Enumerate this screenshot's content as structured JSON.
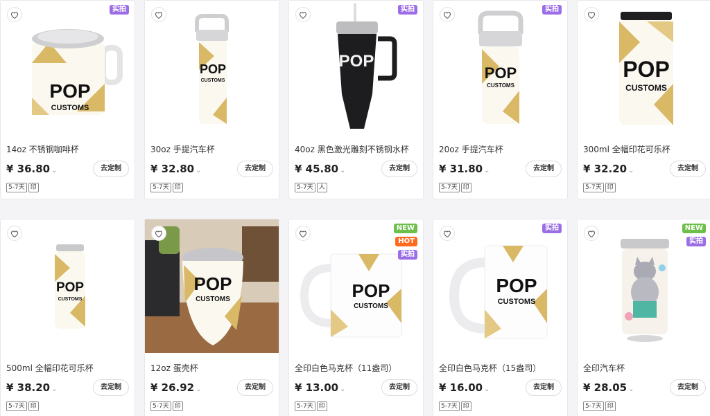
{
  "products": [
    {
      "title": "14oz 不锈钢咖啡杯",
      "price": "¥ 36.80",
      "btn": "去定制",
      "tag1": "5-7天",
      "tag2": "印",
      "badges": [
        "实拍"
      ],
      "brand1": "POP",
      "brand2": "CUSTOMS",
      "icon": "stainless-mug-icon"
    },
    {
      "title": "30oz 手提汽车杯",
      "price": "¥ 32.80",
      "btn": "去定制",
      "tag1": "5-7天",
      "tag2": "印",
      "badges": [],
      "brand1": "POP",
      "brand2": "CUSTOMS",
      "icon": "handle-tumbler-icon"
    },
    {
      "title": "40oz 黑色激光雕刻不锈钢水杯",
      "price": "¥ 45.80",
      "btn": "去定制",
      "tag1": "5-7天",
      "tag2": "人",
      "badges": [
        "实拍"
      ],
      "brand1": "POP",
      "brand2": "",
      "icon": "black-tumbler-icon"
    },
    {
      "title": "20oz 手提汽车杯",
      "price": "¥ 31.80",
      "btn": "去定制",
      "tag1": "5-7天",
      "tag2": "印",
      "badges": [
        "实拍"
      ],
      "brand1": "POP",
      "brand2": "CUSTOMS",
      "icon": "handle-tumbler-icon"
    },
    {
      "title": "300ml 全幅印花可乐杯",
      "price": "¥ 32.20",
      "btn": "去定制",
      "tag1": "5-7天",
      "tag2": "印",
      "badges": [],
      "brand1": "POP",
      "brand2": "CUSTOMS",
      "icon": "cola-can-icon"
    },
    {
      "title": "500ml 全幅印花可乐杯",
      "price": "¥ 38.20",
      "btn": "去定制",
      "tag1": "5-7天",
      "tag2": "印",
      "badges": [],
      "brand1": "POP",
      "brand2": "CUSTOMS",
      "icon": "slim-can-icon"
    },
    {
      "title": "12oz 蛋壳杯",
      "price": "¥ 26.92",
      "btn": "去定制",
      "tag1": "5-7天",
      "tag2": "印",
      "badges": [],
      "brand1": "POP",
      "brand2": "CUSTOMS",
      "icon": "eggshell-cup-icon"
    },
    {
      "title": "全印白色马克杯（11盎司）",
      "price": "¥ 13.00",
      "btn": "去定制",
      "tag1": "5-7天",
      "tag2": "印",
      "badges": [
        "NEW",
        "HOT",
        "实拍"
      ],
      "brand1": "POP",
      "brand2": "CUSTOMS",
      "icon": "white-mug-icon"
    },
    {
      "title": "全印白色马克杯（15盎司）",
      "price": "¥ 16.00",
      "btn": "去定制",
      "tag1": "5-7天",
      "tag2": "印",
      "badges": [
        "实拍"
      ],
      "brand1": "POP",
      "brand2": "CUSTOMS",
      "icon": "white-mug-icon"
    },
    {
      "title": "全印汽车杯",
      "price": "¥ 28.05",
      "btn": "去定制",
      "tag1": "5-7天",
      "tag2": "印",
      "badges": [
        "NEW",
        "实拍"
      ],
      "brand1": "",
      "brand2": "",
      "icon": "cat-tumbler-icon"
    }
  ],
  "colors": {
    "gold": "#d9b866",
    "badge_shipai": "#9c6ee6",
    "badge_new": "#6cc04a",
    "badge_hot": "#ff6a1f"
  }
}
